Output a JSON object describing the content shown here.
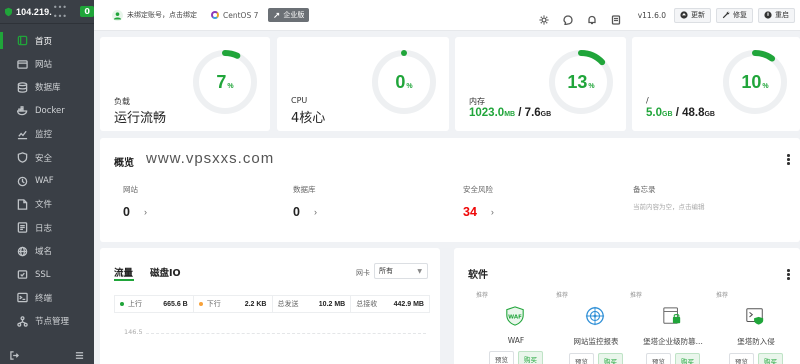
{
  "server": {
    "ip": "104.219.",
    "ip_masked": "••• •••",
    "alert_count": "0"
  },
  "sidebar": {
    "items": [
      {
        "label": "首页",
        "icon": "home-icon",
        "active": true
      },
      {
        "label": "网站",
        "icon": "globe-icon"
      },
      {
        "label": "数据库",
        "icon": "database-icon"
      },
      {
        "label": "Docker",
        "icon": "docker-icon"
      },
      {
        "label": "监控",
        "icon": "monitor-icon"
      },
      {
        "label": "安全",
        "icon": "shield-icon"
      },
      {
        "label": "WAF",
        "icon": "waf-icon"
      },
      {
        "label": "文件",
        "icon": "folder-icon"
      },
      {
        "label": "日志",
        "icon": "log-icon"
      },
      {
        "label": "域名",
        "icon": "domain-icon"
      },
      {
        "label": "SSL",
        "icon": "ssl-icon"
      },
      {
        "label": "终端",
        "icon": "terminal-icon"
      },
      {
        "label": "节点管理",
        "icon": "node-icon"
      }
    ]
  },
  "topbar": {
    "account": "未绑定账号，点击绑定",
    "os": "CentOS 7",
    "edition": "企业版",
    "version": "v11.6.0",
    "buttons": {
      "update": "更新",
      "repair": "修复",
      "restart": "重启"
    }
  },
  "stats": {
    "load": {
      "label": "负载",
      "value": "运行流畅",
      "percent": 7,
      "unit": "%"
    },
    "cpu": {
      "label": "CPU",
      "value": "4核心",
      "percent": 0,
      "unit": "%"
    },
    "memory": {
      "label": "内存",
      "used": "1023.0",
      "used_unit": "MB",
      "sep": " / ",
      "total": "7.6",
      "total_unit": "GB",
      "percent": 13,
      "unit": "%"
    },
    "disk": {
      "label": "/",
      "used": "5.0",
      "used_unit": "GB",
      "sep": " / ",
      "total": "48.8",
      "total_unit": "GB",
      "percent": 10,
      "unit": "%"
    }
  },
  "overview": {
    "title": "概览",
    "watermark": "www.vpsxxs.com",
    "sites": {
      "label": "网站",
      "value": "0"
    },
    "databases": {
      "label": "数据库",
      "value": "0"
    },
    "security": {
      "label": "安全风险",
      "value": "34"
    },
    "memo": {
      "label": "备忘录",
      "note": "当前内容为空，点击编辑"
    }
  },
  "traffic": {
    "tabs": [
      "流量",
      "磁盘IO"
    ],
    "nic_label": "网卡",
    "nic_value": "所有",
    "up_label": "上行",
    "up_value": "665.6 B",
    "down_label": "下行",
    "down_value": "2.2 KB",
    "sent_label": "总发送",
    "sent_value": "10.2 MB",
    "recv_label": "总接收",
    "recv_value": "442.9 MB",
    "axis_top": "146.5",
    "colors": {
      "up": "#20a53a",
      "down": "#f7a23b"
    }
  },
  "software": {
    "title": "软件",
    "items": [
      {
        "tag": "推荐",
        "name": "WAF",
        "icon": "waf-shield-icon",
        "btn1": "预览",
        "btn2": "购买"
      },
      {
        "tag": "推荐",
        "name": "网站监控报表",
        "icon": "radar-icon",
        "btn1": "预览",
        "btn2": "购买"
      },
      {
        "tag": "推荐",
        "name": "堡塔企业级防篡...",
        "icon": "lock-file-icon",
        "btn1": "预览",
        "btn2": "购买"
      },
      {
        "tag": "推荐",
        "name": "堡塔防入侵",
        "icon": "terminal-shield-icon",
        "btn1": "预览",
        "btn2": "购买"
      }
    ]
  },
  "colors": {
    "accent": "#20a53a",
    "danger": "#ef0808",
    "sidebar": "#3a3f46"
  }
}
